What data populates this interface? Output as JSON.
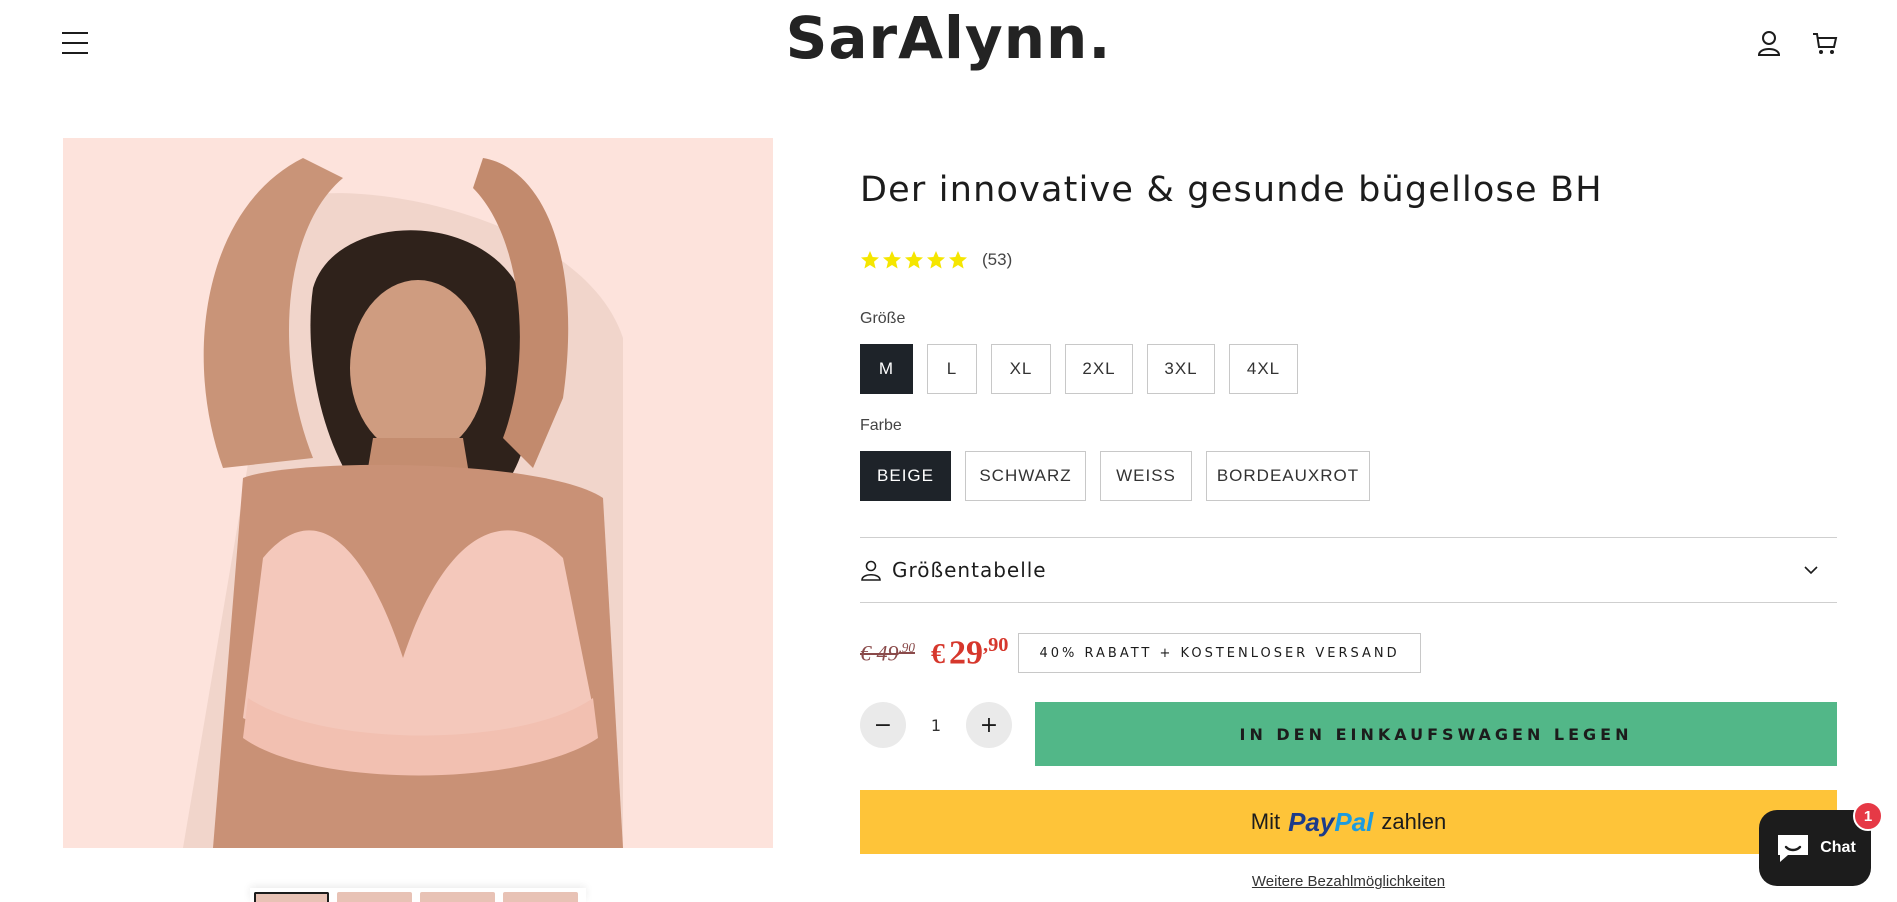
{
  "header": {
    "logo": "SarAlynn.",
    "menu_icon": "hamburger-menu-icon",
    "account_icon": "user-icon",
    "cart_icon": "cart-icon"
  },
  "gallery": {
    "main_image_icon": "product-photo",
    "background_color": "#fde3dc",
    "thumbnail_count": 4
  },
  "product": {
    "title": "Der innovative & gesunde bügellose BH",
    "rating": {
      "stars": 5,
      "count_label": "(53)",
      "star_color": "#f5e600"
    },
    "size": {
      "label": "Größe",
      "options": [
        "M",
        "L",
        "XL",
        "2XL",
        "3XL",
        "4XL"
      ],
      "selected": "M"
    },
    "color": {
      "label": "Farbe",
      "options": [
        "BEIGE",
        "SCHWARZ",
        "WEISS",
        "BORDEAUXROT"
      ],
      "selected": "BEIGE"
    },
    "size_chart": {
      "label": "Größentabelle",
      "icon": "user-outline-icon"
    },
    "price": {
      "old_currency": "€",
      "old_main": "49",
      "old_cents": ",90",
      "new_currency": "€",
      "new_main": "29",
      "new_cents": ",90",
      "badge": "40% RABATT + KOSTENLOSER VERSAND",
      "sale_color": "#d6372c"
    },
    "quantity": {
      "value": "1",
      "minus": "−",
      "plus": "+"
    },
    "add_to_cart": "IN DEN EINKAUFSWAGEN LEGEN",
    "add_to_cart_color": "#52b788",
    "paypal": {
      "prefix": "Mit",
      "brand_1": "Pay",
      "brand_2": "Pal",
      "suffix": "zahlen",
      "color": "#fec439"
    },
    "more_payment": "Weitere Bezahlmöglichkeiten"
  },
  "chat": {
    "label": "Chat",
    "badge": "1"
  }
}
